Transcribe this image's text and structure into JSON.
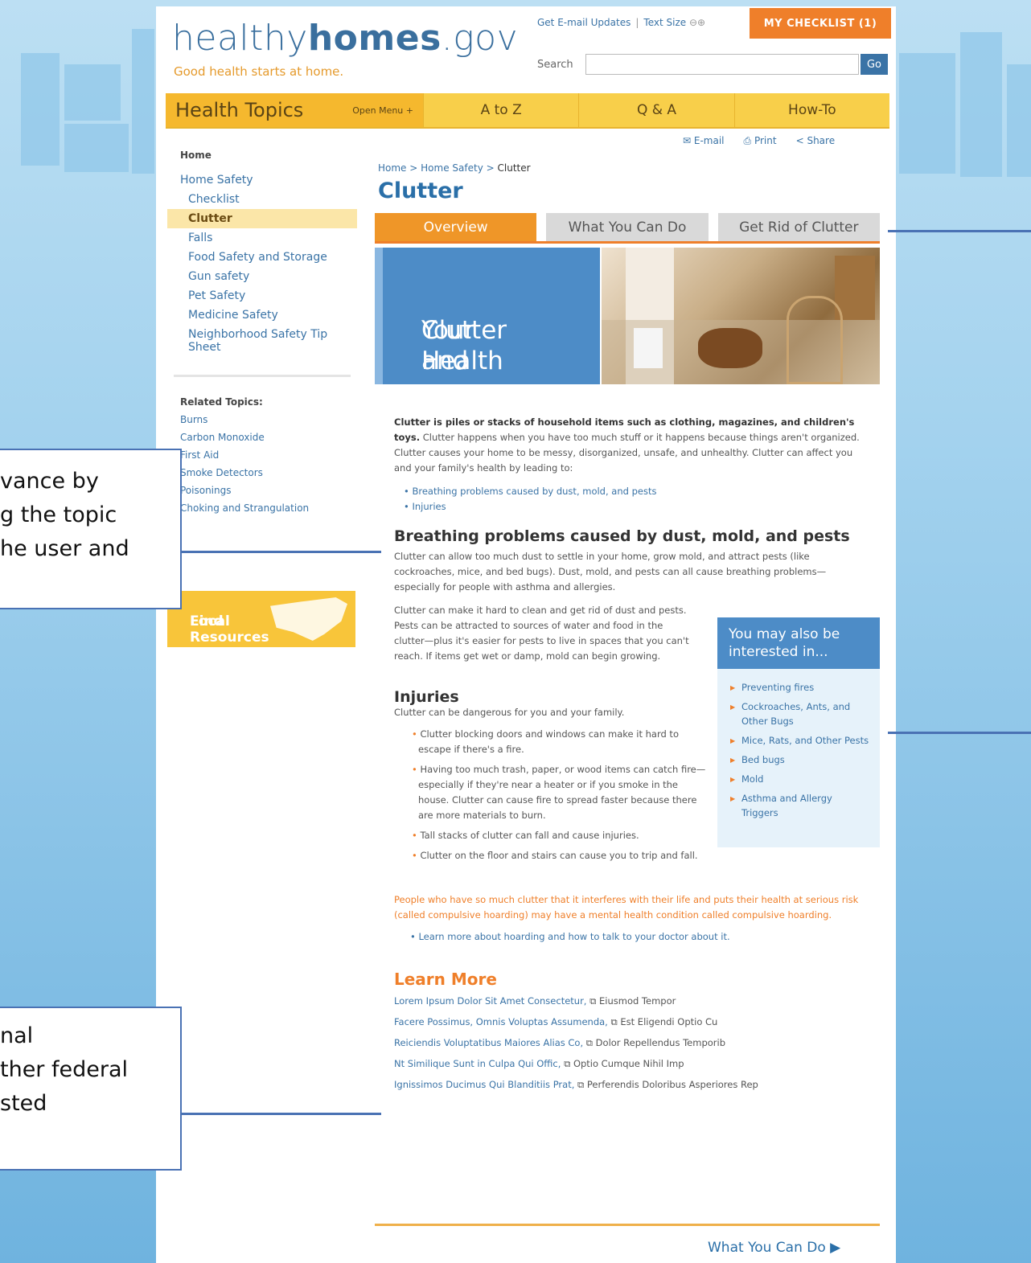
{
  "header": {
    "logo_light": "healthy",
    "logo_bold": "homes",
    "logo_end": ".gov",
    "tagline": "Good health starts at home.",
    "email_updates": "Get E-mail Updates",
    "text_size": "Text Size",
    "checklist": "MY CHECKLIST  (1)",
    "search_label": "Search",
    "go": "Go"
  },
  "nav": {
    "health_topics": "Health Topics",
    "open_menu": "Open Menu +",
    "items": [
      "A to Z",
      "Q & A",
      "How-To"
    ]
  },
  "tools": {
    "email": "E-mail",
    "print": "Print",
    "share": "Share"
  },
  "sidebar": {
    "home": "Home",
    "section": "Home Safety",
    "items": [
      "Checklist",
      "Clutter",
      "Falls",
      "Food Safety and Storage",
      "Gun safety",
      "Pet Safety",
      "Medicine Safety",
      "Neighborhood Safety Tip Sheet"
    ],
    "related_title": "Related Topics:",
    "related": [
      "Burns",
      "Carbon Monoxide",
      "First Aid",
      "Smoke Detectors",
      "Poisonings",
      "Choking and Strangulation"
    ],
    "find_1": "Find",
    "find_2": "Local Resources"
  },
  "breadcrumb": {
    "home": "Home",
    "sep": ">",
    "section": "Home Safety",
    "current": "Clutter"
  },
  "page_title": "Clutter",
  "tabs": [
    "Overview",
    "What You Can Do",
    "Get Rid of Clutter"
  ],
  "hero": {
    "line1": "Clutter and",
    "line2": "Your Health"
  },
  "content": {
    "intro_bold": "Clutter is piles or stacks of household items such as clothing, magazines, and children's toys.",
    "intro_rest": " Clutter happens when you have too much stuff or it happens because things aren't organized. Clutter causes your home to be messy, disorganized, unsafe, and unhealthy. Clutter can affect you and your family's health by leading to:",
    "bullets": [
      "Breathing problems caused by dust, mold, and pests",
      "Injuries"
    ],
    "h_breathing": "Breathing problems caused by dust, mold, and pests",
    "p_breathing1": "Clutter can allow too much dust to settle in your home, grow mold, and attract pests (like cockroaches, mice, and bed bugs). Dust, mold, and pests can all cause breathing problems—especially for people with asthma and allergies.",
    "p_breathing2": "Clutter can make it hard to clean and get rid of dust and pests.  Pests can be attracted to sources of water and food in the clutter—plus it's easier for pests to live in spaces that you can't reach. If items get wet or damp, mold can begin growing.",
    "h_injuries": "Injuries",
    "p_injuries": "Clutter can be dangerous for you and your family.",
    "injury_bullets": [
      "Clutter blocking doors and windows can make it hard to escape if there's a fire.",
      "Having too much trash, paper, or wood items can catch fire—especially if they're near a heater or if you smoke in the house. Clutter can cause fire to spread faster because there are more materials to burn.",
      "Tall stacks of clutter can fall and cause injuries.",
      "Clutter on the floor and stairs can cause you to trip and fall."
    ],
    "hoarding": "People who have so much clutter that it interferes with their life and puts their health at serious risk (called compulsive hoarding) may have a mental health condition called compulsive hoarding.",
    "hoarding_link": "Learn more about hoarding and how to talk to your doctor about it."
  },
  "related_box": {
    "title": "You may also be interested in...",
    "items": [
      "Preventing fires",
      "Cockroaches, Ants, and Other Bugs",
      "Mice, Rats, and Other Pests",
      "Bed bugs",
      "Mold",
      "Asthma and Allergy Triggers"
    ]
  },
  "learn_more": {
    "title": "Learn More",
    "links": [
      {
        "a": "Lorem Ipsum Dolor Sit Amet Consectetur,",
        "b": "Eiusmod Tempor"
      },
      {
        "a": "Facere Possimus, Omnis Voluptas Assumenda,",
        "b": "Est Eligendi Optio Cu"
      },
      {
        "a": "Reiciendis Voluptatibus Maiores Alias Co,",
        "b": "Dolor Repellendus Temporib"
      },
      {
        "a": "Nt Similique Sunt in Culpa Qui Offic,",
        "b": "Optio Cumque Nihil Imp"
      },
      {
        "a": "Ignissimos Ducimus Qui Blanditiis Prat,",
        "b": "Perferendis Doloribus Asperiores Rep"
      }
    ]
  },
  "next_link": "What You Can Do",
  "callouts": {
    "left1": [
      "vance by",
      "g the topic",
      "he user and"
    ],
    "left2": [
      "nal",
      "ther federal",
      "sted"
    ]
  }
}
